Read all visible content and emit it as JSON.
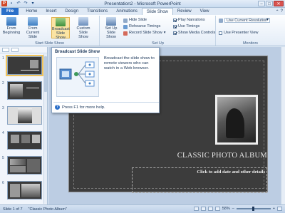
{
  "window": {
    "title": "Presentation2 - Microsoft PowerPoint",
    "app_icon": "P"
  },
  "tabs": [
    "File",
    "Home",
    "Insert",
    "Design",
    "Transitions",
    "Animations",
    "Slide Show",
    "Review",
    "View"
  ],
  "active_tab": "Slide Show",
  "ribbon": {
    "groups": {
      "start": "Start Slide Show",
      "setup": "Set Up",
      "monitors": "Monitors"
    },
    "buttons": {
      "from_beginning": "From Beginning",
      "from_current": "From Current Slide",
      "broadcast": "Broadcast Slide Show",
      "custom": "Custom Slide Show",
      "setup_show": "Set Up Slide Show",
      "hide_slide": "Hide Slide",
      "rehearse": "Rehearse Timings",
      "record": "Record Slide Show",
      "play_narrations": "Play Narrations",
      "use_timings": "Use Timings",
      "show_media": "Show Media Controls",
      "resolution": "Use Current Resolution",
      "presenter_view": "Use Presenter View"
    },
    "checks": {
      "play_narrations": true,
      "use_timings": true,
      "show_media": true,
      "presenter_view": false
    }
  },
  "tooltip": {
    "title": "Broadcast Slide Show",
    "body": "Broadcast the slide show to remote viewers who can watch in a Web browser.",
    "help": "Press F1 for more help."
  },
  "slides": [
    {
      "num": "1"
    },
    {
      "num": "2"
    },
    {
      "num": "3"
    },
    {
      "num": "4"
    },
    {
      "num": "5"
    },
    {
      "num": "6"
    }
  ],
  "slide": {
    "title": "CLASSIC PHOTO ALBUM",
    "subtitle": "Click to add date and other details"
  },
  "status": {
    "slide": "Slide 1 of 7",
    "theme": "\"Classic Photo Album\"",
    "zoom": "58%"
  },
  "colors": {
    "file_tab": "#2a6fc9",
    "accent": "#f2c45a",
    "slide_bg": "#3c3c3c"
  }
}
